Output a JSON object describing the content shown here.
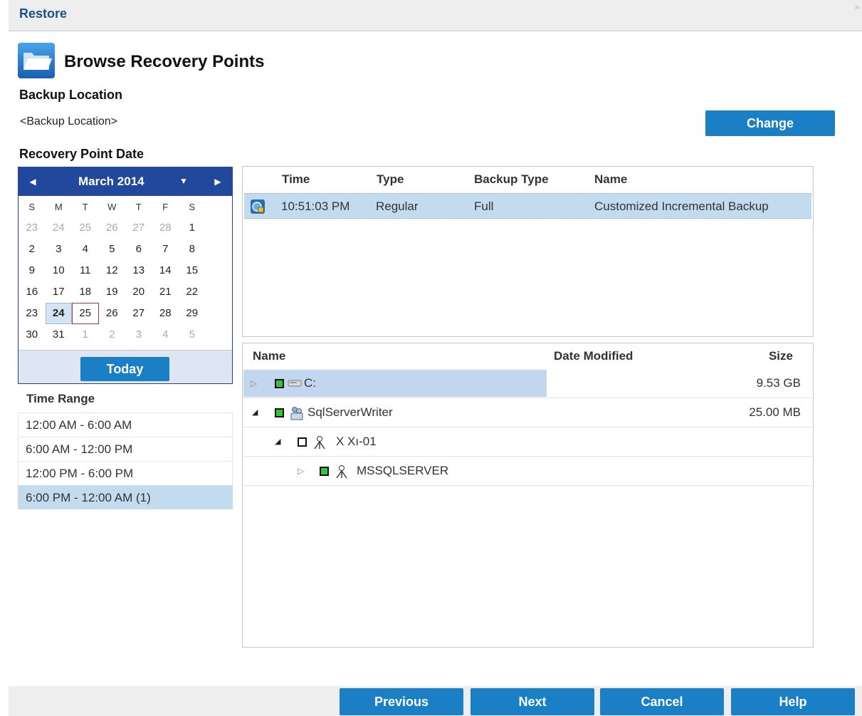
{
  "window": {
    "title": "Restore"
  },
  "header": {
    "title": "Browse Recovery Points",
    "icon": "folder-icon"
  },
  "backup_location": {
    "label": "Backup Location",
    "value": "<Backup Location>",
    "change_button": "Change"
  },
  "recovery_point_date": {
    "label": "Recovery Point Date",
    "calendar": {
      "month_label": "March 2014",
      "weekdays": [
        "S",
        "M",
        "T",
        "W",
        "T",
        "F",
        "S"
      ],
      "weeks": [
        [
          "23",
          "24",
          "25",
          "26",
          "27",
          "28",
          "1"
        ],
        [
          "2",
          "3",
          "4",
          "5",
          "6",
          "7",
          "8"
        ],
        [
          "9",
          "10",
          "11",
          "12",
          "13",
          "14",
          "15"
        ],
        [
          "16",
          "17",
          "18",
          "19",
          "20",
          "21",
          "22"
        ],
        [
          "23",
          "24",
          "25",
          "26",
          "27",
          "28",
          "29"
        ],
        [
          "30",
          "31",
          "1",
          "2",
          "3",
          "4",
          "5"
        ]
      ],
      "current_date": "24",
      "selected_date": "25",
      "today_button": "Today"
    }
  },
  "time_range": {
    "label": "Time Range",
    "items": [
      "12:00 AM - 6:00 AM",
      "6:00 AM - 12:00 PM",
      "12:00 PM - 6:00 PM",
      "6:00 PM - 12:00 AM  (1)"
    ],
    "selected_index": 3
  },
  "recovery_points": {
    "columns": [
      "Time",
      "Type",
      "Backup Type",
      "Name"
    ],
    "rows": [
      {
        "time": "10:51:03 PM",
        "type": "Regular",
        "backup_type": "Full",
        "name": "Customized Incremental Backup",
        "icon": "backup-status-icon"
      }
    ]
  },
  "file_tree": {
    "columns": [
      "Name",
      "Date Modified",
      "Size"
    ],
    "rows": [
      {
        "name": "C:",
        "size": "9.53 GB",
        "icon": "drive-icon",
        "checked": true,
        "expanded": false
      },
      {
        "name": "SqlServerWriter",
        "size": "25.00 MB",
        "icon": "writer-icon",
        "checked": true,
        "expanded": true
      },
      {
        "name": "X Xı-01",
        "size": "",
        "icon": "component-icon",
        "checked": false,
        "expanded": true
      },
      {
        "name": "MSSQLSERVER",
        "size": "",
        "icon": "component-icon",
        "checked": true,
        "expanded": false
      }
    ]
  },
  "footer": {
    "previous": "Previous",
    "next": "Next",
    "cancel": "Cancel",
    "help": "Help"
  },
  "colors": {
    "accent": "#1a7fc4",
    "calendar_header": "#21489c",
    "selection": "#c3dbef",
    "title": "#1f4e8a"
  }
}
